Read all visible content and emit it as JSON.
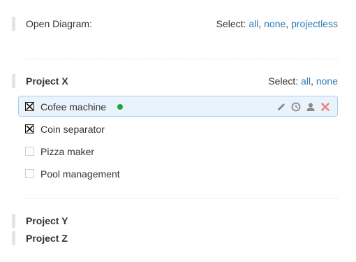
{
  "header": {
    "title": "Open Diagram:",
    "select_label": "Select:",
    "links": [
      {
        "label": "all"
      },
      {
        "label": "none"
      },
      {
        "label": "projectless"
      }
    ]
  },
  "project_x": {
    "title": "Project X",
    "select_label": "Select:",
    "links": [
      {
        "label": "all"
      },
      {
        "label": "none"
      }
    ],
    "items": [
      {
        "label": "Cofee machine",
        "checked": true,
        "active": true,
        "status_color": "#1fa33a"
      },
      {
        "label": "Coin separator",
        "checked": true,
        "active": false
      },
      {
        "label": "Pizza maker",
        "checked": false,
        "active": false
      },
      {
        "label": "Pool management",
        "checked": false,
        "active": false
      }
    ]
  },
  "project_y": {
    "title": "Project Y"
  },
  "project_z": {
    "title": "Project Z"
  },
  "colors": {
    "link": "#2a7ab8",
    "active_bg": "#e9f3fc",
    "active_border": "#a9cff0",
    "status": "#1fa33a",
    "delete": "#f08080",
    "icon": "#8a8a8a"
  },
  "tools": [
    {
      "icon": "pencil-icon"
    },
    {
      "icon": "clock-icon"
    },
    {
      "icon": "user-icon"
    },
    {
      "icon": "close-icon"
    }
  ]
}
